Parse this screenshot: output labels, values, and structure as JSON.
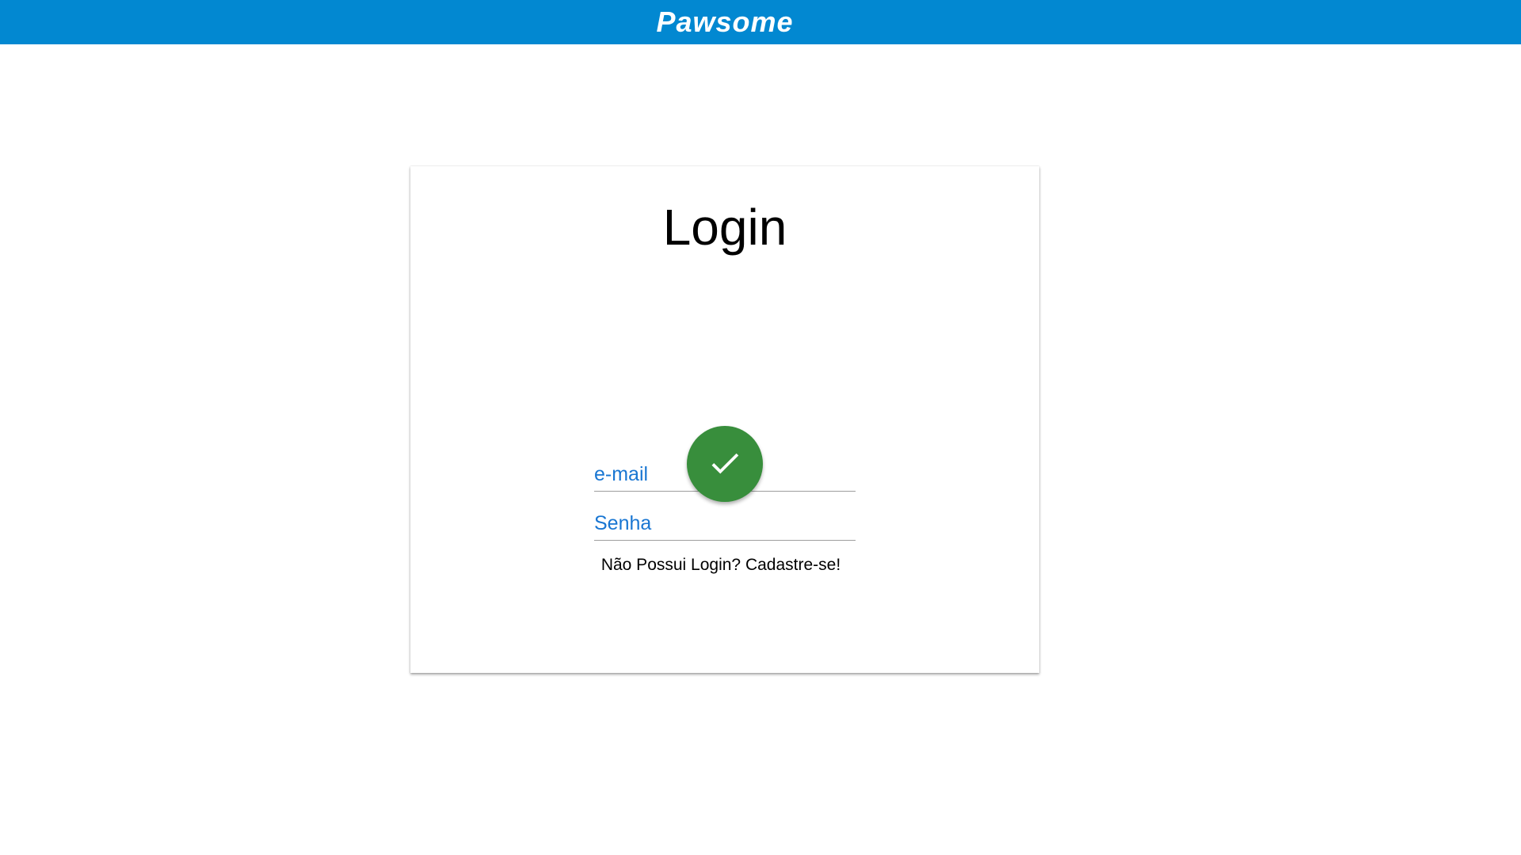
{
  "header": {
    "brand": "Pawsome",
    "background_color": "#0288d1"
  },
  "login": {
    "title": "Login",
    "email_placeholder": "e-mail",
    "password_placeholder": "Senha",
    "submit_icon": "check-icon",
    "submit_color": "#388e3c",
    "signup_text": "Não Possui Login? Cadastre-se!"
  }
}
